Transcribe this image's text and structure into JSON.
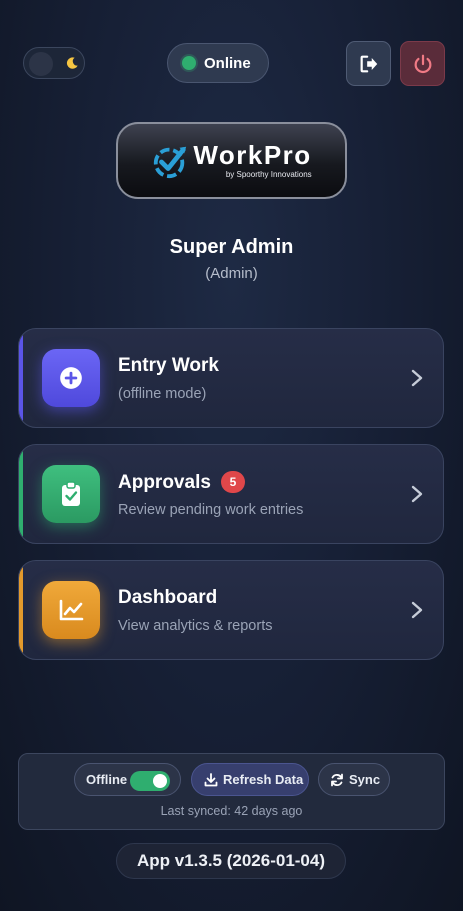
{
  "header": {
    "status_label": "Online",
    "status_color": "#2fae6f",
    "theme_icon": "moon-icon",
    "logout_icon": "logout-icon",
    "power_icon": "power-icon"
  },
  "logo": {
    "name": "WorkPro",
    "tagline": "by Spoorthy Innovations",
    "brand_color": "#2a9fd6"
  },
  "user": {
    "name": "Super Admin",
    "role": "(Admin)"
  },
  "menu": [
    {
      "title": "Entry Work",
      "subtitle": "(offline mode)",
      "icon": "plus-circle-icon",
      "accent": "#5b55e8"
    },
    {
      "title": "Approvals",
      "subtitle": "Review pending work entries",
      "icon": "clipboard-check-icon",
      "badge": "5",
      "accent": "#2fae6f"
    },
    {
      "title": "Dashboard",
      "subtitle": "View analytics & reports",
      "icon": "chart-line-icon",
      "accent": "#e39a2c"
    }
  ],
  "footer": {
    "offline_label": "Offline",
    "offline_toggle_on": true,
    "refresh_label": "Refresh Data",
    "sync_label": "Sync",
    "last_synced": "Last synced: 42 days ago",
    "version": "App v1.3.5 (2026-01-04)"
  }
}
